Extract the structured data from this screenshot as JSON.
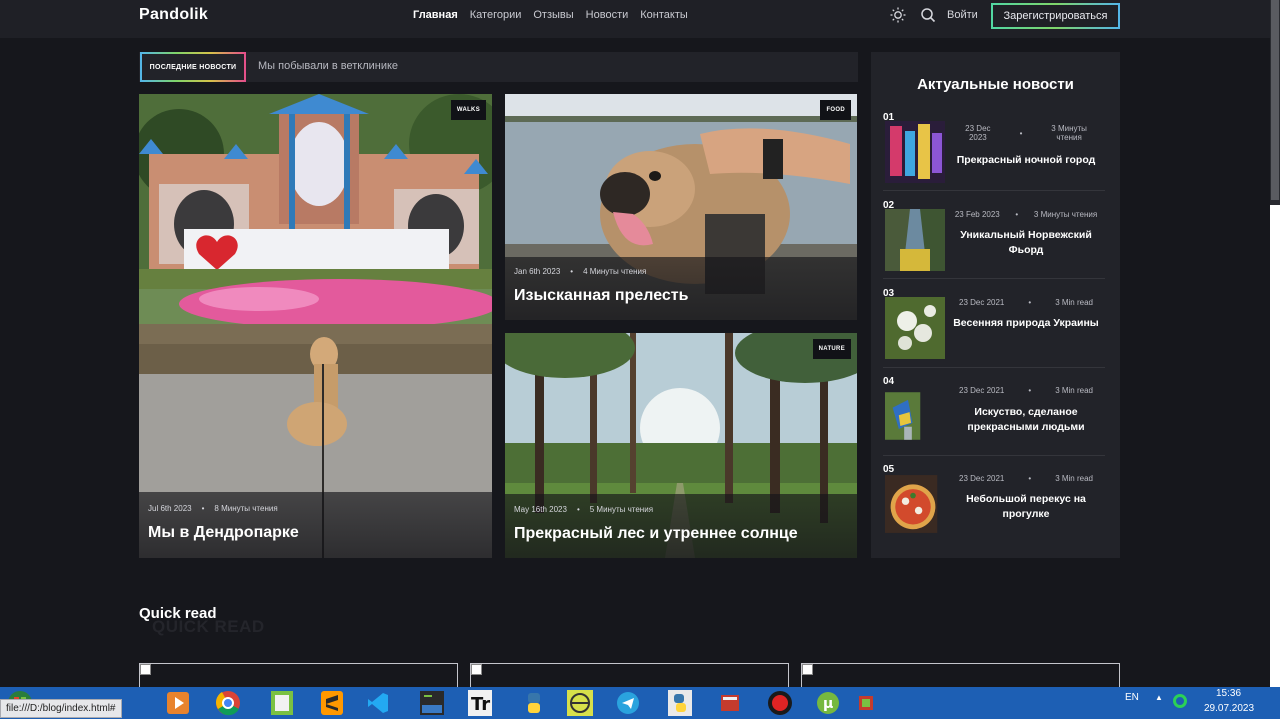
{
  "header": {
    "logo": "Pandolik",
    "nav": [
      "Главная",
      "Категории",
      "Отзывы",
      "Новости",
      "Контакты"
    ],
    "login": "Войти",
    "register": "Зарегистрироваться"
  },
  "ticker": {
    "badge": "ПОСЛЕДНИЕ НОВОСТИ",
    "text": "Мы побывали в ветклинике"
  },
  "cards": [
    {
      "tag": "WALKS",
      "date": "Jul 6th 2023",
      "read": "8 Минуты чтения",
      "title": "Мы в Дендропарке"
    },
    {
      "tag": "FOOD",
      "date": "Jan 6th 2023",
      "read": "4 Минуты чтения",
      "title": "Изысканная прелесть"
    },
    {
      "tag": "NATURE",
      "date": "May 16th 2023",
      "read": "5 Минуты чтения",
      "title": "Прекрасный лес и утреннее солнце"
    }
  ],
  "sidebar": {
    "title": "Актуальные новости",
    "items": [
      {
        "num": "01",
        "date": "23 Dec 2023",
        "read": "3 Минуты чтения",
        "title": "Прекрасный ночной город"
      },
      {
        "num": "02",
        "date": "23 Feb 2023",
        "read": "3 Минуты чтения",
        "title": "Уникальный Норвежский Фьорд"
      },
      {
        "num": "03",
        "date": "23 Dec 2021",
        "read": "3 Min read",
        "title": "Весенняя природа Украины"
      },
      {
        "num": "04",
        "date": "23 Dec 2021",
        "read": "3 Min read",
        "title": "Искуство, сделаное прекрасными людьми"
      },
      {
        "num": "05",
        "date": "23 Dec 2021",
        "read": "3 Min read",
        "title": "Небольшой перекус на прогулке"
      }
    ]
  },
  "quick_read": {
    "title": "Quick read",
    "shadow": "QUICK READ"
  },
  "status_bar": "file:///D:/blog/index.html#",
  "tray": {
    "lang": "EN",
    "time": "15:36",
    "date": "29.07.2023"
  },
  "taskbar_icons": [
    "start-icon",
    "media-player-icon",
    "chrome-icon",
    "notepad-icon",
    "sublime-icon",
    "vscode-icon",
    "terminal-icon",
    "typora-icon",
    "python-icon",
    "app-icon",
    "telegram-icon",
    "python-shell-icon",
    "books-icon",
    "recorder-icon",
    "utorrent-icon"
  ]
}
